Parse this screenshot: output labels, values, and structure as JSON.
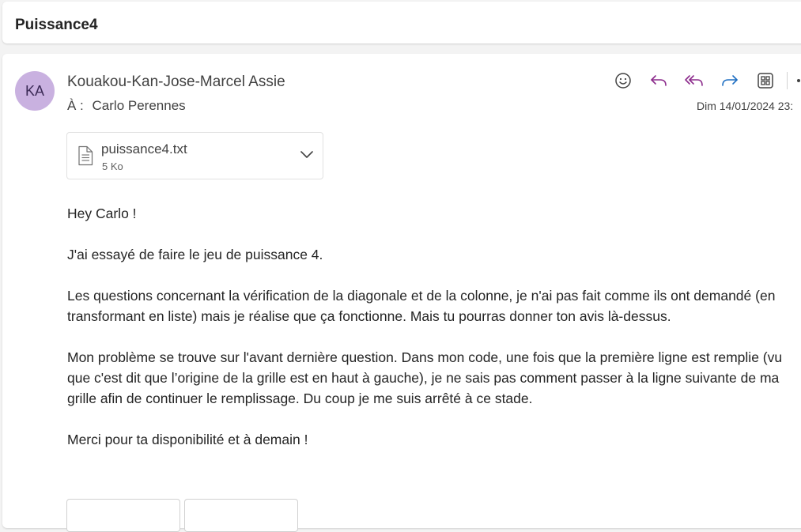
{
  "subject": "Puissance4",
  "message": {
    "avatar_initials": "KA",
    "sender": "Kouakou-Kan-Jose-Marcel Assie",
    "to_label": "À :",
    "recipient": "Carlo Perennes",
    "date": "Dim 14/01/2024 23:",
    "actions": [
      {
        "name": "emoji-icon",
        "color": "#424242"
      },
      {
        "name": "reply-icon",
        "color": "#8b2a8b"
      },
      {
        "name": "reply-all-icon",
        "color": "#8b2a8b"
      },
      {
        "name": "forward-icon",
        "color": "#1f6fc2"
      },
      {
        "name": "apps-icon",
        "color": "#424242"
      },
      {
        "name": "more-icon",
        "color": "#424242"
      }
    ],
    "attachment": {
      "name": "puissance4.txt",
      "size": "5 Ko",
      "icon": "document-icon"
    },
    "body": [
      "Hey Carlo !",
      "J'ai essayé de faire le jeu de puissance 4.",
      "Les questions concernant la vérification de la diagonale et de la colonne, je n'ai pas fait comme ils ont demandé (en transformant en liste) mais je réalise que ça fonctionne. Mais tu pourras donner ton avis là-dessus.",
      "Mon problème se trouve sur l'avant dernière question. Dans mon code, une fois que la première ligne est remplie (vu que c'est dit que l’origine de la grille est en haut à gauche), je ne sais pas comment passer à la ligne suivante de ma grille afin de continuer le remplissage. Du coup je me suis arrêté à ce stade.",
      "Merci pour ta disponibilité et à demain !"
    ]
  },
  "colors": {
    "avatar_bg": "#c9b1e0",
    "reply_accent": "#8b2a8b",
    "forward_accent": "#1f6fc2"
  }
}
